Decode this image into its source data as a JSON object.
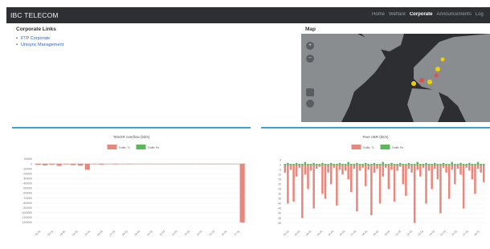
{
  "navbar": {
    "brand": "IBC TELECOM",
    "links": [
      {
        "label": "Home",
        "active": false
      },
      {
        "label": "Weffare",
        "active": false
      },
      {
        "label": "Corporate",
        "active": true
      },
      {
        "label": "Announcements",
        "active": false
      },
      {
        "label": "Log",
        "active": false
      }
    ]
  },
  "corporate_links": {
    "title": "Corporate Links",
    "items": [
      "FTP Corporate",
      "Unisync Management"
    ]
  },
  "map": {
    "title": "Map",
    "controls": [
      "+",
      "−"
    ],
    "colors": {
      "water": "#2c2e31",
      "land": "#8a8d90",
      "marker_red": "#d9534f",
      "marker_yellow": "#f0d000"
    }
  },
  "colors": {
    "tx": "#e8877c",
    "rx": "#5cb85c",
    "divider": "#36a7dc"
  },
  "chart_data": [
    {
      "type": "bar",
      "title": "TeleGR overflow (bit/s)",
      "legend": [
        "Traffic Tx",
        "Traffic Rx"
      ],
      "legend_position": "top",
      "yticks": [
        "100000",
        "0",
        "-100000",
        "-200000",
        "-300000",
        "-400000",
        "-500000",
        "-600000",
        "-700000",
        "-800000",
        "-900000",
        "-1000000",
        "-1100000",
        "-1200000"
      ],
      "ylim": [
        -1250000,
        100000
      ],
      "xticks": [
        "01-01",
        "02-01",
        "03-01",
        "04-01",
        "05-01",
        "06-01",
        "07-01",
        "08-01",
        "09-01",
        "10-01",
        "11-01",
        "12-01",
        "13-01",
        "14-01",
        "15-01",
        "16-01",
        "17-01"
      ],
      "series": [
        {
          "name": "Traffic Tx",
          "values": [
            -20000,
            -30000,
            -15000,
            -40000,
            -10000,
            -25000,
            -35000,
            -120000,
            -8000,
            -15000,
            -5000,
            -10000,
            -5000,
            -8000,
            -5000,
            -5000,
            -3000,
            -4000,
            -5000,
            -3000,
            -4000,
            -5000,
            -3000,
            -4000,
            -3000,
            -5000,
            -4000,
            -3000,
            -5000,
            -1200000
          ]
        },
        {
          "name": "Traffic Rx",
          "values": [
            1000,
            1000,
            1000,
            1000,
            1000,
            1000,
            1000,
            1000,
            1000,
            1000,
            1000,
            1000,
            1000,
            1000,
            1000,
            1000,
            1000,
            1000,
            1000,
            1000,
            1000,
            1000,
            1000,
            1000,
            1000,
            1000,
            1000,
            1000,
            1000,
            1000
          ]
        }
      ]
    },
    {
      "type": "bar",
      "title": "Peer eBR (bit/s)",
      "legend": [
        "Traffic Tx",
        "Traffic Rx"
      ],
      "legend_position": "top",
      "yticks": [
        "5",
        "0",
        "-5",
        "-10",
        "-15",
        "-20",
        "-25",
        "-30",
        "-35",
        "-40",
        "-45",
        "-50",
        "-55",
        "-60"
      ],
      "ylim": [
        -62,
        6
      ],
      "xticks": [
        "01-01",
        "02-01",
        "03-01",
        "04-01",
        "05-01",
        "06-01",
        "07-01",
        "08-01",
        "09-01",
        "10-01",
        "11-01",
        "12-01",
        "13-01",
        "14-01",
        "15-01",
        "16-01",
        "17-01",
        "18-01"
      ],
      "series": [
        {
          "name": "Traffic Tx",
          "values": [
            -8,
            -40,
            -5,
            -38,
            -12,
            -3,
            -55,
            -10,
            -25,
            -6,
            -45,
            -4,
            -2,
            -30,
            -35,
            -8,
            -20,
            -3,
            -42,
            -5,
            -10,
            -6,
            -15,
            -28,
            -4,
            -48,
            -6,
            -3,
            -22,
            -5,
            -52,
            -8,
            -4,
            -40,
            -12,
            -3,
            -25,
            -5,
            -38,
            -6,
            -2,
            -20,
            -32,
            -4,
            -8,
            -60,
            -5,
            -12,
            -3,
            -40,
            -6,
            -25,
            -4,
            -15,
            -50,
            -3,
            -8,
            -35,
            -5,
            -20,
            -4,
            -10,
            -45,
            -3,
            -6,
            -15,
            -30,
            -4,
            -8,
            -18
          ]
        },
        {
          "name": "Traffic Rx",
          "values": [
            1,
            2,
            1,
            1,
            2,
            1,
            1,
            3,
            1,
            1,
            2,
            1,
            1,
            2,
            1,
            1,
            2,
            1,
            1,
            2,
            1,
            1,
            3,
            1,
            1,
            2,
            1,
            1,
            2,
            1,
            1,
            2,
            1,
            1,
            3,
            1,
            1,
            2,
            1,
            1,
            2,
            1,
            1,
            2,
            1,
            1,
            3,
            1,
            1,
            2,
            1,
            1,
            2,
            1,
            1,
            2,
            1,
            1,
            3,
            1,
            1,
            2,
            1,
            1,
            2,
            1,
            1,
            3,
            1,
            1
          ]
        }
      ]
    }
  ]
}
